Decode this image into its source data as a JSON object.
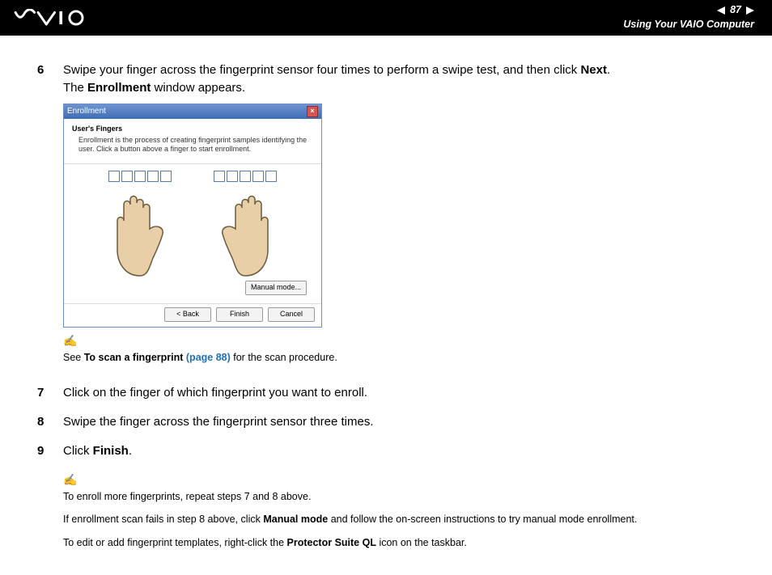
{
  "header": {
    "page_number": "87",
    "section": "Using Your VAIO Computer"
  },
  "steps": {
    "6": {
      "num": "6",
      "t1": "Swipe your finger across the fingerprint sensor four times to perform a swipe test, and then click ",
      "b1": "Next",
      "t2": ".",
      "t3": "The ",
      "b2": "Enrollment",
      "t4": " window appears."
    },
    "7": {
      "num": "7",
      "text": "Click on the finger of which fingerprint you want to enroll."
    },
    "8": {
      "num": "8",
      "text": "Swipe the finger across the fingerprint sensor three times."
    },
    "9": {
      "num": "9",
      "t1": "Click ",
      "b1": "Finish",
      "t2": "."
    }
  },
  "dialog": {
    "title": "Enrollment",
    "close": "×",
    "heading": "User's Fingers",
    "desc": "Enrollment is the process of creating fingerprint samples identifying the user. Click a button above a finger to start enrollment.",
    "manual_mode": "Manual mode...",
    "back": "< Back",
    "finish": "Finish",
    "cancel": "Cancel"
  },
  "note1": {
    "t1": "See ",
    "b1": "To scan a fingerprint ",
    "link": "(page 88)",
    "t2": " for the scan procedure."
  },
  "note2": {
    "line1": "To enroll more fingerprints, repeat steps 7 and 8 above.",
    "l2a": "If enrollment scan fails in step 8 above, click ",
    "l2b": "Manual mode",
    "l2c": " and follow the on-screen instructions to try manual mode enrollment.",
    "l3a": "To edit or add fingerprint templates, right-click the ",
    "l3b": "Protector Suite QL",
    "l3c": " icon on the taskbar."
  }
}
